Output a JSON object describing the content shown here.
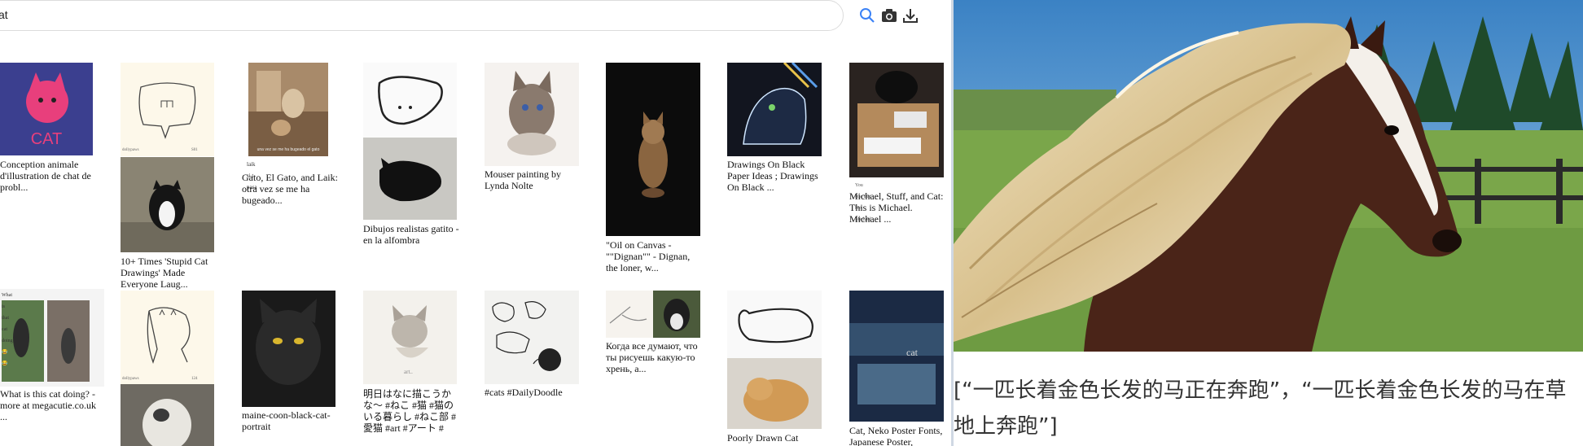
{
  "search": {
    "query": "cat"
  },
  "toolbar": {
    "search_icon": "search-icon",
    "camera_icon": "camera-icon",
    "download_icon": "download-icon"
  },
  "results": [
    {
      "caption": "Conception animale d'illustration de chat de probl...",
      "art": "pink-cat"
    },
    {
      "caption": "10+ Times 'Stupid Cat Drawings' Made Everyone Laug...",
      "art": "drawn-bubble",
      "overlay": "dollypaws",
      "overlay2": "S01 | 14"
    },
    {
      "caption": "Gato, El Gato, and Laik: otra vez se me ha bugeado...",
      "art": "hallway-cats",
      "overlay": "laik si t pasa"
    },
    {
      "caption": "Dibujos realistas gatito - en la alfombra",
      "art": "blob-drawing"
    },
    {
      "caption": "Mouser painting by Lynda Nolte",
      "art": "watercolor-cat"
    },
    {
      "caption": "\"Oil on Canvas - \"\"Dignan\"\" - Dignan, the loner, w...",
      "art": "oil-cat"
    },
    {
      "caption": "Drawings On Black Paper Ideas ; Drawings On Black ...",
      "art": "black-paper"
    },
    {
      "caption": "Michael, Stuff, and Cat: This is Michael. Michael ...",
      "art": "box-cat",
      "overlay": "You bite that box Michael"
    },
    {
      "caption": "What is this cat doing? - more at megacutie.co.uk ...",
      "art": "memes",
      "overlay": "What is that cat doing 😂😂"
    },
    {
      "caption": "",
      "art": "round-drawing",
      "overlay": "dollypaws",
      "overlay2": "124 | 96"
    },
    {
      "caption": "maine-coon-black-cat-portrait",
      "art": "black-cat"
    },
    {
      "caption": "明日はなに描こうかな〜 #ねこ #猫 #猫のいる暮らし #ねこ部 #愛猫 #art #アート #",
      "art": "sketch-cat"
    },
    {
      "caption": "#cats #DailyDoodle",
      "art": "doodles"
    },
    {
      "caption": "Когда все думают, что ты рисуешь какую-то хрень, а...",
      "art": "hand-draw"
    },
    {
      "caption": "Poorly Drawn Cat",
      "art": "poorly-drawn"
    },
    {
      "caption": "Cat, Neko Poster Fonts, Japanese Poster,",
      "art": "neko-poster"
    }
  ],
  "detail": {
    "image": "horse-running-golden-mane",
    "caption": "[“一匹长着金色长发的马正在奔跑”，“一匹长着金色长发的马在草地上奔跑”]"
  },
  "colors": {
    "divider": "#cfd8e3",
    "icon": "#3b82f6"
  }
}
